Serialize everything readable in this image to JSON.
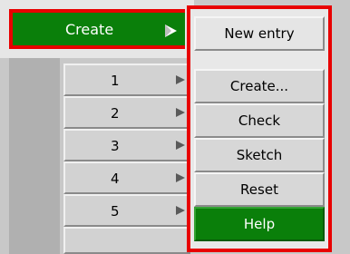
{
  "header": {
    "label": "Create"
  },
  "rows": [
    {
      "label": "1"
    },
    {
      "label": "2"
    },
    {
      "label": "3"
    },
    {
      "label": "4"
    },
    {
      "label": "5"
    }
  ],
  "menu": {
    "title": "New entry",
    "items": [
      {
        "label": "Create..."
      },
      {
        "label": "Check"
      },
      {
        "label": "Sketch"
      },
      {
        "label": "Reset"
      },
      {
        "label": "Help"
      }
    ]
  },
  "colors": {
    "accent": "#0a7f0a",
    "outline": "#e80000"
  }
}
